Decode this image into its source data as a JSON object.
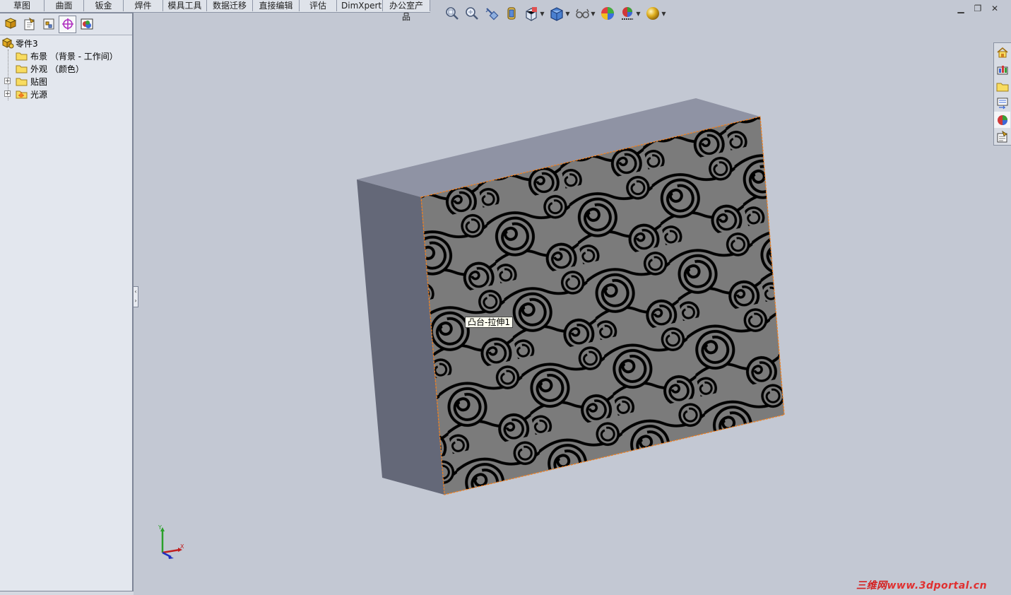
{
  "command_tabs": [
    "草图",
    "曲面",
    "钣金",
    "焊件",
    "模具工具",
    "数据迁移",
    "直接编辑",
    "评估",
    "DimXpert",
    "办公室产品"
  ],
  "heads_up_toolbar": [
    {
      "name": "zoom-to-fit-icon",
      "dropdown": false
    },
    {
      "name": "zoom-to-area-icon",
      "dropdown": false
    },
    {
      "name": "previous-view-icon",
      "dropdown": false
    },
    {
      "name": "section-view-icon",
      "dropdown": false
    },
    {
      "name": "view-orientation-icon",
      "dropdown": true
    },
    {
      "name": "display-style-icon",
      "dropdown": true
    },
    {
      "name": "hide-show-items-icon",
      "dropdown": true
    },
    {
      "name": "edit-appearance-icon",
      "dropdown": false
    },
    {
      "name": "apply-scene-icon",
      "dropdown": true
    },
    {
      "name": "view-settings-icon",
      "dropdown": true
    }
  ],
  "manager_tabs": [
    {
      "name": "featuremanager-tab",
      "active": false
    },
    {
      "name": "propertymanager-tab",
      "active": false
    },
    {
      "name": "configurationmanager-tab",
      "active": false
    },
    {
      "name": "dimxpertmanager-tab",
      "active": true
    },
    {
      "name": "displaymanager-tab",
      "active": false
    }
  ],
  "tree": {
    "root": "零件3",
    "items": [
      {
        "label": "布景 （背景 - 工作间）",
        "expandable": false
      },
      {
        "label": "外观 （颜色）",
        "expandable": false
      },
      {
        "label": "贴图",
        "expandable": true
      },
      {
        "label": "光源",
        "expandable": true
      }
    ]
  },
  "task_pane": [
    "solidworks-resources-icon",
    "design-library-icon",
    "file-explorer-icon",
    "view-palette-icon",
    "appearances-scenes-icon",
    "custom-properties-icon"
  ],
  "tooltip": "凸台-拉伸1",
  "triad": {
    "x": "X",
    "y": "Y"
  },
  "watermark": {
    "brand": "三维网",
    "url": "www.3dportal.cn"
  },
  "colors": {
    "face_highlight": "#f08020",
    "decal_bg": "#7b7b7b",
    "side_face": "#646878",
    "top_face": "#8f93a4"
  }
}
